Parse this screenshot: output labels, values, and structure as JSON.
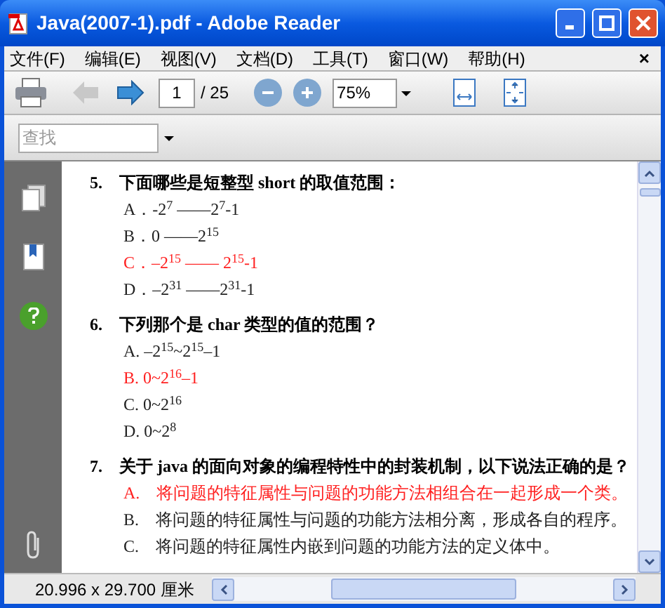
{
  "window": {
    "title": "Java(2007-1).pdf - Adobe Reader"
  },
  "menu": [
    {
      "label": "文件(F)"
    },
    {
      "label": "编辑(E)"
    },
    {
      "label": "视图(V)"
    },
    {
      "label": "文档(D)"
    },
    {
      "label": "工具(T)"
    },
    {
      "label": "窗口(W)"
    },
    {
      "label": "帮助(H)"
    }
  ],
  "menu_close": "×",
  "toolbar": {
    "page": "1",
    "page_count": "/ 25",
    "zoom": "75%"
  },
  "find": {
    "placeholder": "查找"
  },
  "questions": [
    {
      "number": "5.",
      "text": "下面哪些是短整型 short 的取值范围：",
      "options": [
        {
          "text": "A．-2$^{7}$ ——2$^{7}$-1",
          "selected": false
        },
        {
          "text": "B．0 ——2$^{15}$",
          "selected": false
        },
        {
          "text": "C．–2$^{15}$ —— 2$^{15}$-1",
          "selected": true
        },
        {
          "text": "D．–2$^{31}$ ——2$^{31}$-1",
          "selected": false
        }
      ]
    },
    {
      "number": "6.",
      "text": "下列那个是 char 类型的值的范围？",
      "options": [
        {
          "text": "A. –2$^{15}$~2$^{15}$–1",
          "selected": false
        },
        {
          "text": "B. 0~2$^{16}$–1",
          "selected": true
        },
        {
          "text": "C. 0~2$^{16}$",
          "selected": false
        },
        {
          "text": "D. 0~2$^{8}$",
          "selected": false
        }
      ]
    },
    {
      "number": "7.",
      "text": "关于 java 的面向对象的编程特性中的封装机制，以下说法正确的是？",
      "options": [
        {
          "text": "A.　将问题的特征属性与问题的功能方法相组合在一起形成一个类。",
          "selected": true
        },
        {
          "text": "B.　将问题的特征属性与问题的功能方法相分离，形成各自的程序。",
          "selected": false
        },
        {
          "text": "C.　将问题的特征属性内嵌到问题的功能方法的定义体中。",
          "selected": false
        }
      ]
    }
  ],
  "status_bar": {
    "page_size": "20.996 x 29.700 厘米"
  }
}
